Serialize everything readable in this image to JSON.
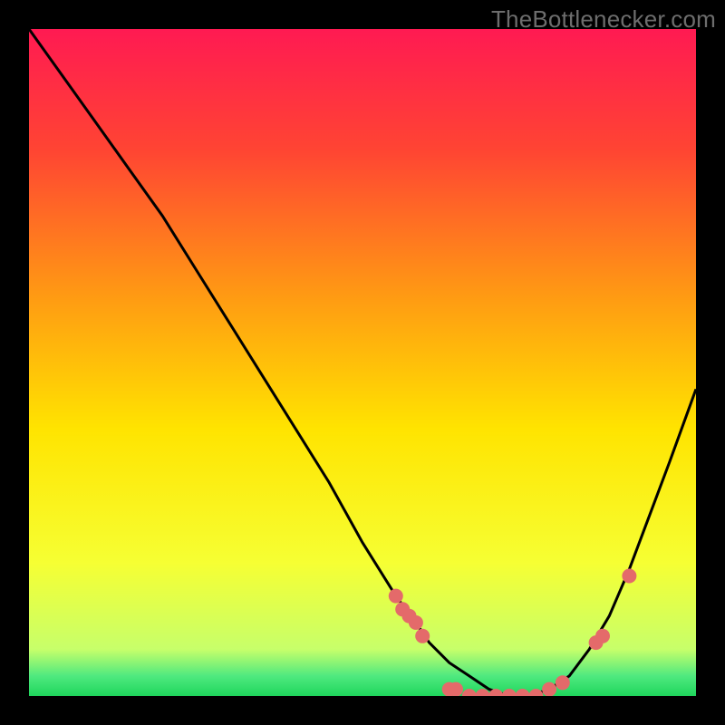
{
  "watermark": "TheBottlenecker.com",
  "chart_data": {
    "type": "line",
    "title": "",
    "xlabel": "",
    "ylabel": "",
    "xlim": [
      0,
      100
    ],
    "ylim": [
      0,
      100
    ],
    "legend": false,
    "grid": false,
    "background_gradient": {
      "stops": [
        {
          "offset": 0.0,
          "color": "#ff1a52"
        },
        {
          "offset": 0.18,
          "color": "#ff4433"
        },
        {
          "offset": 0.4,
          "color": "#ff9a13"
        },
        {
          "offset": 0.6,
          "color": "#ffe400"
        },
        {
          "offset": 0.8,
          "color": "#f6ff33"
        },
        {
          "offset": 0.93,
          "color": "#c7ff6a"
        },
        {
          "offset": 0.97,
          "color": "#4fe97f"
        },
        {
          "offset": 1.0,
          "color": "#1fd65c"
        }
      ]
    },
    "series": [
      {
        "name": "bottleneck-curve",
        "stroke": "#000000",
        "x": [
          0,
          5,
          10,
          15,
          20,
          25,
          30,
          35,
          40,
          45,
          50,
          55,
          58,
          60,
          63,
          66,
          69,
          72,
          75,
          78,
          81,
          84,
          87,
          90,
          93,
          96,
          100
        ],
        "y": [
          100,
          93,
          86,
          79,
          72,
          64,
          56,
          48,
          40,
          32,
          23,
          15,
          11,
          8,
          5,
          3,
          1,
          0,
          0,
          1,
          3,
          7,
          12,
          19,
          27,
          35,
          46
        ]
      }
    ],
    "markers": {
      "name": "sample-points",
      "color": "#e46a6a",
      "radius": 8,
      "points": [
        {
          "x": 55,
          "y": 15
        },
        {
          "x": 56,
          "y": 13
        },
        {
          "x": 57,
          "y": 12
        },
        {
          "x": 58,
          "y": 11
        },
        {
          "x": 59,
          "y": 9
        },
        {
          "x": 63,
          "y": 1
        },
        {
          "x": 64,
          "y": 1
        },
        {
          "x": 66,
          "y": 0
        },
        {
          "x": 68,
          "y": 0
        },
        {
          "x": 70,
          "y": 0
        },
        {
          "x": 72,
          "y": 0
        },
        {
          "x": 74,
          "y": 0
        },
        {
          "x": 76,
          "y": 0
        },
        {
          "x": 78,
          "y": 1
        },
        {
          "x": 80,
          "y": 2
        },
        {
          "x": 85,
          "y": 8
        },
        {
          "x": 86,
          "y": 9
        },
        {
          "x": 90,
          "y": 18
        }
      ]
    }
  }
}
